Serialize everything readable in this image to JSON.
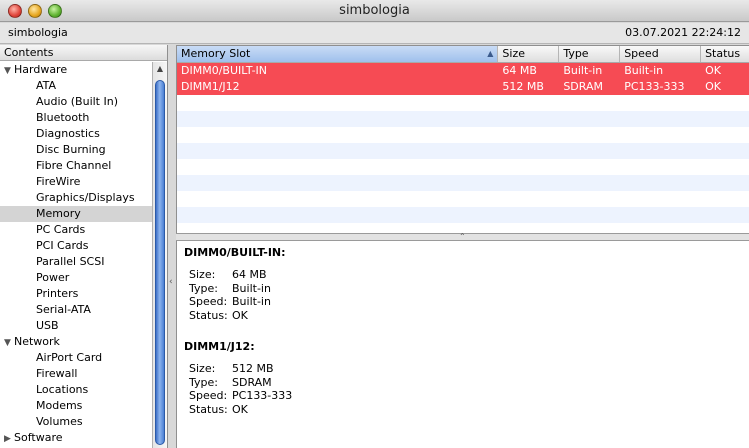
{
  "window": {
    "title": "simbologia"
  },
  "toolbar": {
    "host": "simbologia",
    "timestamp": "03.07.2021 22:24:12"
  },
  "sidebar": {
    "header": "Contents",
    "tree": [
      {
        "type": "group",
        "label": "Hardware"
      },
      {
        "type": "child",
        "label": "ATA"
      },
      {
        "type": "child",
        "label": "Audio (Built In)"
      },
      {
        "type": "child",
        "label": "Bluetooth"
      },
      {
        "type": "child",
        "label": "Diagnostics"
      },
      {
        "type": "child",
        "label": "Disc Burning"
      },
      {
        "type": "child",
        "label": "Fibre Channel"
      },
      {
        "type": "child",
        "label": "FireWire"
      },
      {
        "type": "child",
        "label": "Graphics/Displays"
      },
      {
        "type": "child",
        "label": "Memory",
        "selected": true
      },
      {
        "type": "child",
        "label": "PC Cards"
      },
      {
        "type": "child",
        "label": "PCI Cards"
      },
      {
        "type": "child",
        "label": "Parallel SCSI"
      },
      {
        "type": "child",
        "label": "Power"
      },
      {
        "type": "child",
        "label": "Printers"
      },
      {
        "type": "child",
        "label": "Serial-ATA"
      },
      {
        "type": "child",
        "label": "USB"
      },
      {
        "type": "group",
        "label": "Network"
      },
      {
        "type": "child",
        "label": "AirPort Card"
      },
      {
        "type": "child",
        "label": "Firewall"
      },
      {
        "type": "child",
        "label": "Locations"
      },
      {
        "type": "child",
        "label": "Modems"
      },
      {
        "type": "child",
        "label": "Volumes"
      },
      {
        "type": "group",
        "label": "Software"
      }
    ]
  },
  "table": {
    "columns": [
      "Memory Slot",
      "Size",
      "Type",
      "Speed",
      "Status"
    ],
    "sort_column": "Memory Slot",
    "rows": [
      {
        "slot": "DIMM0/BUILT-IN",
        "size": "64 MB",
        "type": "Built-in",
        "speed": "Built-in",
        "status": "OK",
        "selected": true
      },
      {
        "slot": "DIMM1/J12",
        "size": "512 MB",
        "type": "SDRAM",
        "speed": "PC133-333",
        "status": "OK",
        "selected": true
      }
    ],
    "empty_rows": 9
  },
  "detail": {
    "sections": [
      {
        "title": "DIMM0/BUILT-IN:",
        "fields": [
          {
            "key": "Size:",
            "value": "64 MB"
          },
          {
            "key": "Type:",
            "value": "Built-in"
          },
          {
            "key": "Speed:",
            "value": "Built-in"
          },
          {
            "key": "Status:",
            "value": "OK"
          }
        ]
      },
      {
        "title": "DIMM1/J12:",
        "fields": [
          {
            "key": "Size:",
            "value": "512 MB"
          },
          {
            "key": "Type:",
            "value": "SDRAM"
          },
          {
            "key": "Speed:",
            "value": "PC133-333"
          },
          {
            "key": "Status:",
            "value": "OK"
          }
        ]
      }
    ]
  },
  "colors": {
    "selection_red": "#f64b54",
    "stripe": "#edf3fe",
    "scroll_thumb": "#4a7fd4"
  }
}
